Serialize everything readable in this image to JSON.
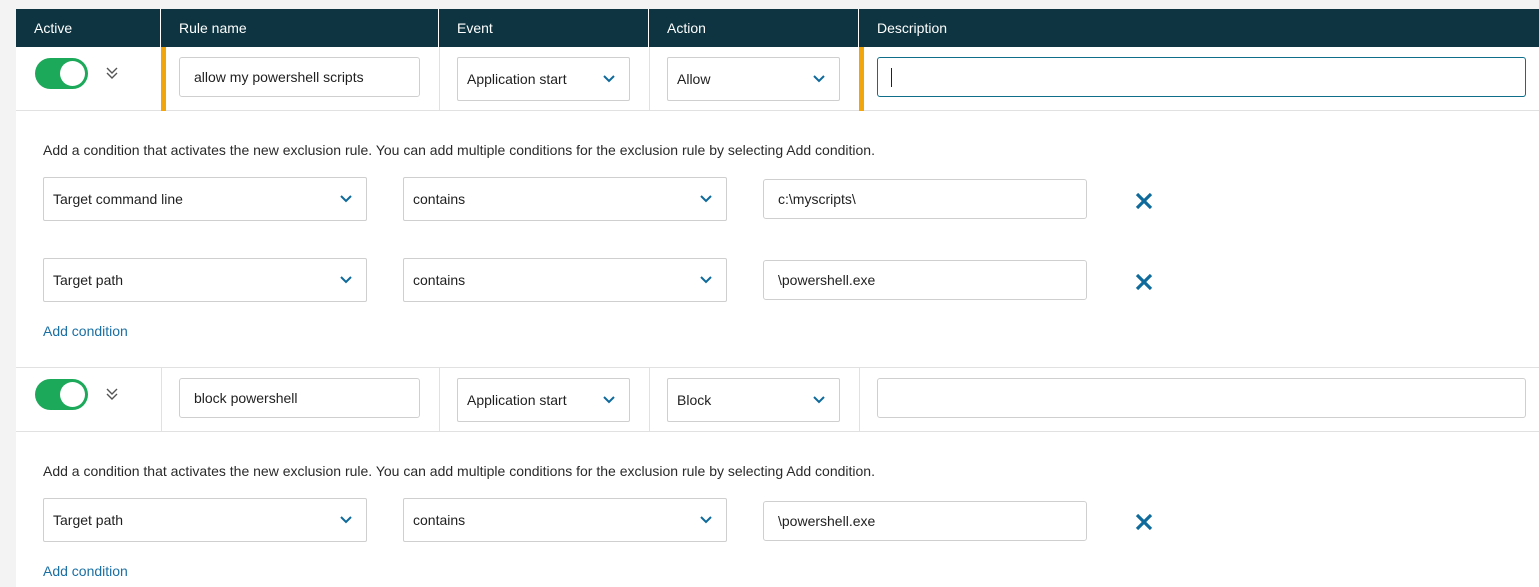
{
  "header": {
    "active": "Active",
    "rule_name": "Rule name",
    "event": "Event",
    "action": "Action",
    "description": "Description"
  },
  "rules": [
    {
      "active": true,
      "rule_name": "allow my powershell scripts",
      "event": "Application start",
      "action": "Allow",
      "description": "",
      "condition_hint": "Add a condition that activates the new exclusion rule. You can add multiple conditions for the exclusion rule by selecting Add condition.",
      "conditions": [
        {
          "field": "Target command line",
          "operator": "contains",
          "value": "c:\\myscripts\\"
        },
        {
          "field": "Target path",
          "operator": "contains",
          "value": "\\powershell.exe"
        }
      ],
      "add_condition": "Add condition"
    },
    {
      "active": true,
      "rule_name": "block powershell",
      "event": "Application start",
      "action": "Block",
      "description": "",
      "condition_hint": "Add a condition that activates the new exclusion rule. You can add multiple conditions for the exclusion rule by selecting Add condition.",
      "conditions": [
        {
          "field": "Target path",
          "operator": "contains",
          "value": "\\powershell.exe"
        }
      ],
      "add_condition": "Add condition"
    }
  ],
  "icons": {
    "expand": "double-chevron-down-icon",
    "dropdown": "chevron-down-icon",
    "remove": "close-icon"
  },
  "colors": {
    "header_bg": "#0d3440",
    "toggle_on": "#1ca95a",
    "modified_accent": "#f2a60d",
    "link": "#1a6fa3",
    "remove_icon": "#0f6a9c"
  }
}
